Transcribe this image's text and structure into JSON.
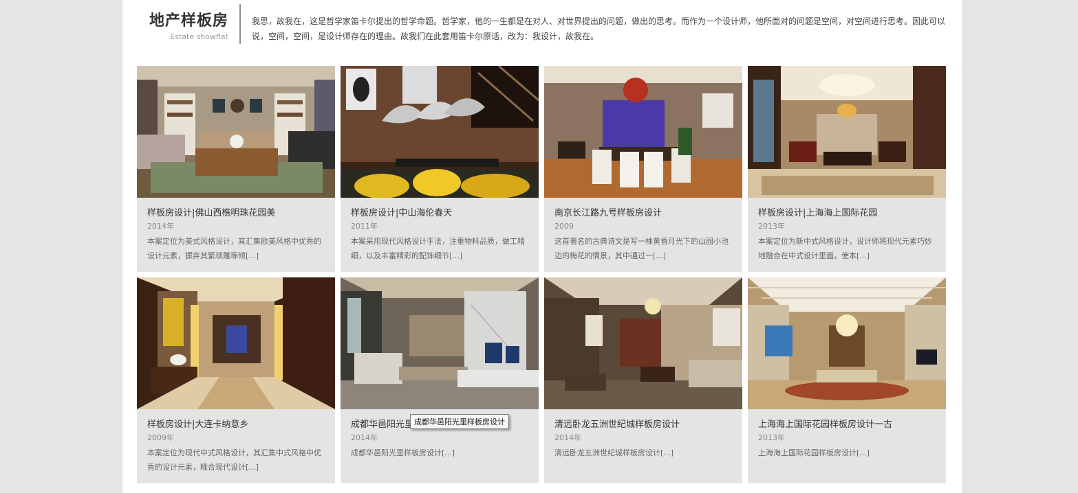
{
  "header": {
    "title": "地产样板房",
    "subtitle": "Estate showflat",
    "intro": "我思，故我在，这是哲学家笛卡尔提出的哲学命题。哲学家，他的一生都是在对人、对世界提出的问题，做出的思考。而作为一个设计师，他所面对的问题是空间，对空间进行思考。因此可以说，空间，空间，是设计师存在的理由。故我们在此套用笛卡尔原话，改为：我设计，故我在。"
  },
  "projects": [
    {
      "title": "样板房设计|佛山西樵明珠花园美",
      "year": "2014年",
      "desc": "本案定位为美式风格设计，其汇集欧美风格中优秀的设计元素，摒弃其繁琐雕琢倾[...]"
    },
    {
      "title": "样板房设计|中山海伦春天",
      "year": "2011年",
      "desc": "本案采用现代风格设计手法，注重物料品质，做工精细，以及丰富精彩的配饰细节[...]"
    },
    {
      "title": "南京长江路九号样板房设计",
      "year": "2009",
      "desc": "这首著名的古典诗文是写一株黄昏月光下的山园小池边的梅花的情景，其中通过一[...]"
    },
    {
      "title": "样板房设计|上海海上国际花园",
      "year": "2013年",
      "desc": "本案定位为新中式风格设计，设计师将现代元素巧妙地融合在中式设计里面。使本[...]"
    },
    {
      "title": "样板房设计|大连卡纳意乡",
      "year": "2009年",
      "desc": "本案定位为现代中式风格设计，其汇集中式风格中优秀的设计元素，糅合现代设计[...]"
    },
    {
      "title": "成都华邑阳光里样板房设计",
      "year": "2014年",
      "desc": "成都华邑阳光里样板房设计[...]"
    },
    {
      "title": "清远卧龙五洲世纪城样板房设计",
      "year": "2014年",
      "desc": "清远卧龙五洲世纪城样板房设计[...]"
    },
    {
      "title": "上海海上国际花园样板房设计一古",
      "year": "2013年",
      "desc": "上海海上国际花园样板房设计[...]"
    }
  ],
  "tooltip": "成都华邑阳光里样板房设计"
}
